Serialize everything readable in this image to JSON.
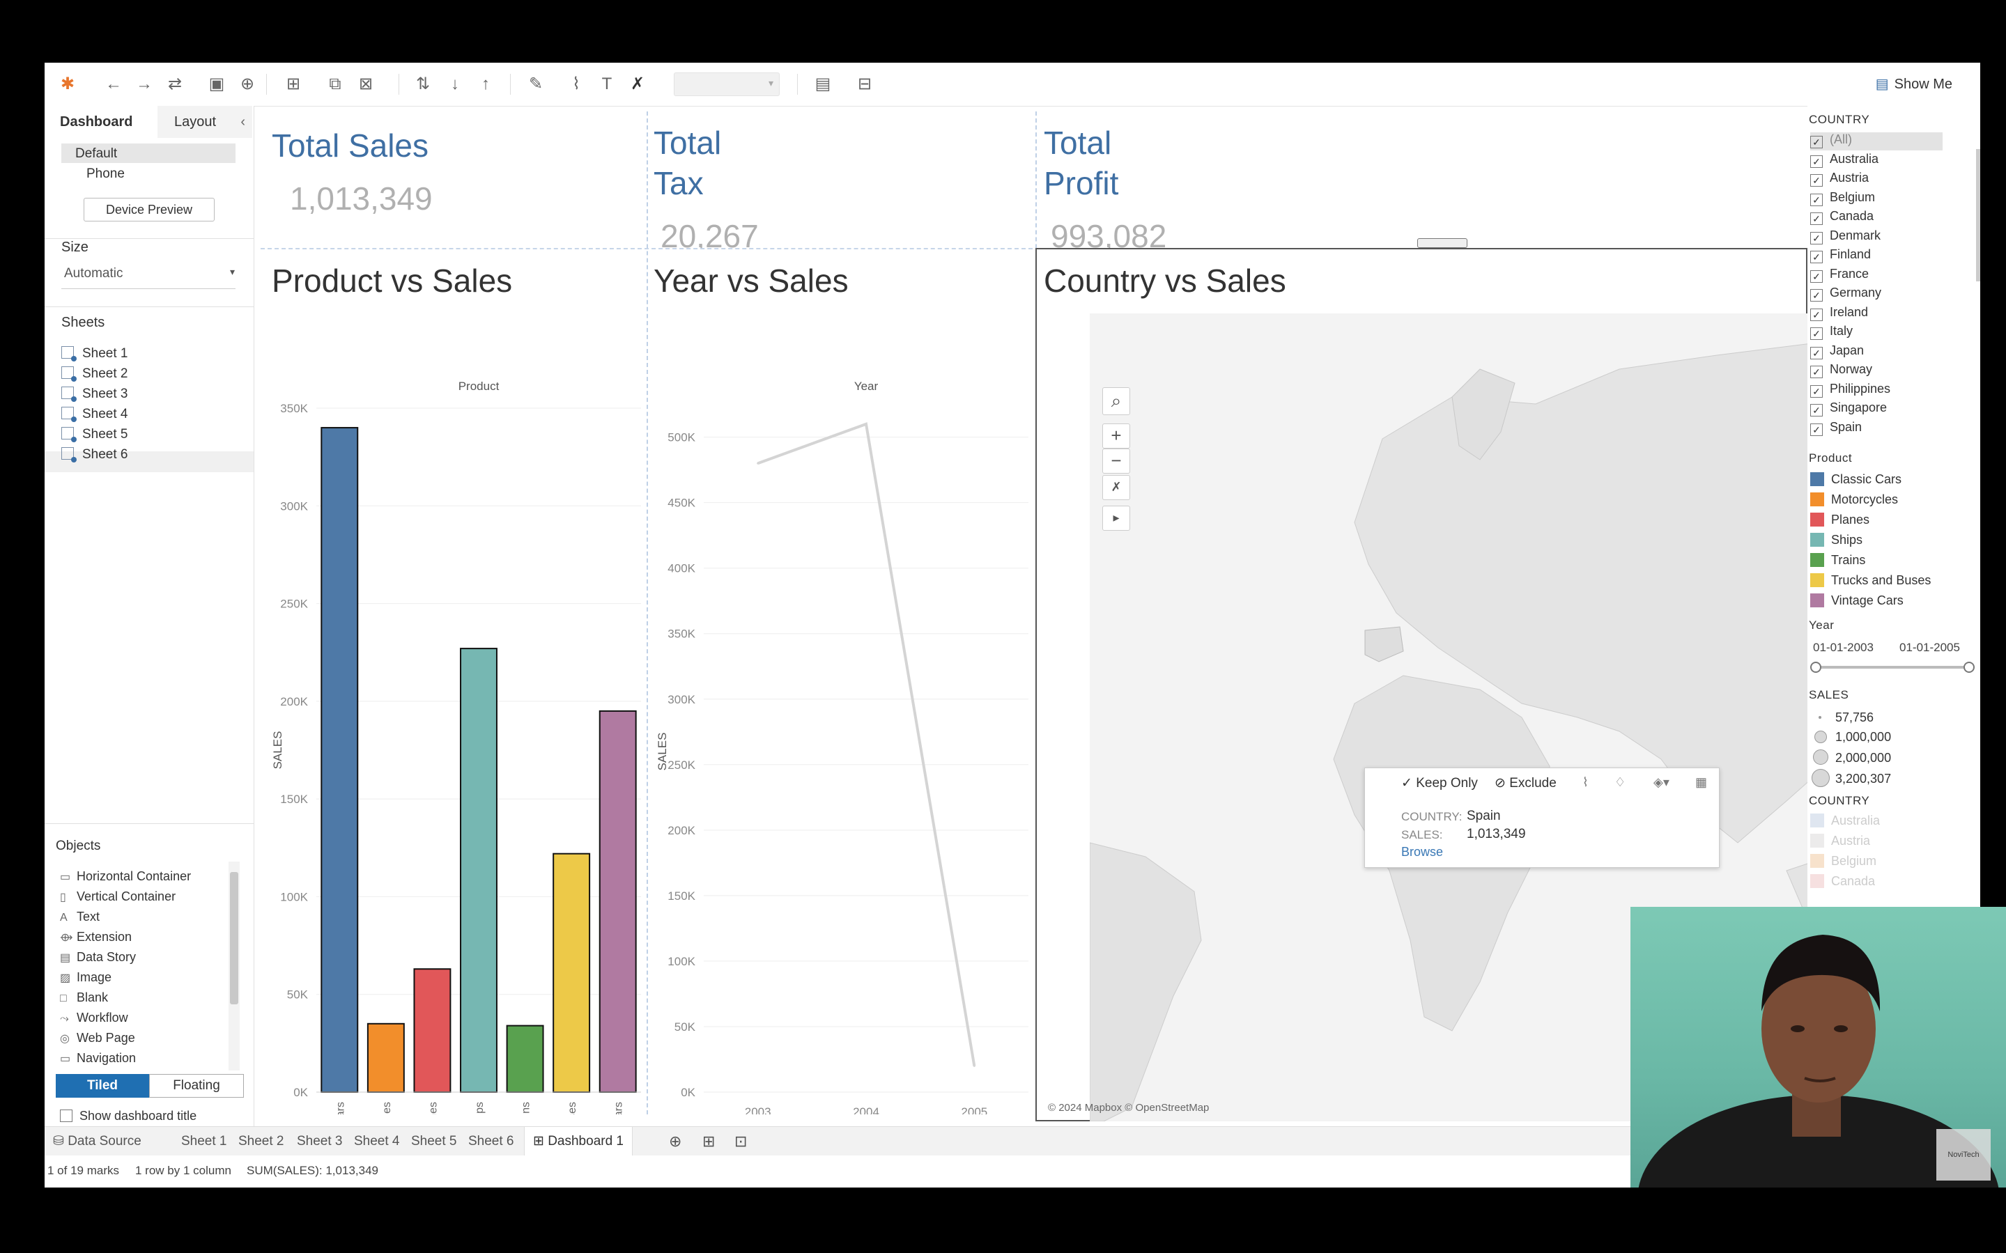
{
  "toolbar": {
    "show_me_label": "Show Me"
  },
  "left_panel": {
    "tabs": [
      "Dashboard",
      "Layout"
    ],
    "devices": [
      "Default",
      "Phone"
    ],
    "device_preview_label": "Device Preview",
    "size_heading": "Size",
    "size_value": "Automatic",
    "sheets_heading": "Sheets",
    "sheets": [
      "Sheet 1",
      "Sheet 2",
      "Sheet 3",
      "Sheet 4",
      "Sheet 5",
      "Sheet 6"
    ],
    "objects_heading": "Objects",
    "objects": [
      "Horizontal Container",
      "Vertical Container",
      "Text",
      "Extension",
      "Data Story",
      "Image",
      "Blank",
      "Workflow",
      "Web Page",
      "Navigation"
    ],
    "tiled_label": "Tiled",
    "floating_label": "Floating",
    "show_title_label": "Show dashboard title"
  },
  "kpis": {
    "total_sales_title": "Total Sales",
    "total_sales_value": "1,013,349",
    "total_tax_title_1": "Total",
    "total_tax_title_2": "Tax",
    "total_tax_value": "20,267",
    "total_profit_title_1": "Total",
    "total_profit_title_2": "Profit",
    "total_profit_value": "993,082"
  },
  "charts": {
    "product_title": "Product vs Sales",
    "year_title": "Year vs Sales",
    "country_title": "Country vs Sales",
    "map_attribution": "© 2024 Mapbox © OpenStreetMap"
  },
  "chart_data": [
    {
      "type": "bar",
      "title": "Product vs Sales",
      "xlabel": "Product",
      "ylabel": "SALES",
      "categories": [
        "Classic Cars",
        "Motorcycles",
        "Planes",
        "Ships",
        "Trains",
        "Trucks and Buses",
        "Vintage Cars"
      ],
      "values": [
        340000,
        35000,
        63000,
        227000,
        34000,
        122000,
        195000
      ],
      "colors": [
        "#4e79a7",
        "#f28e2b",
        "#e15759",
        "#76b7b2",
        "#59a14f",
        "#edc948",
        "#b07aa1"
      ],
      "ylim": [
        0,
        350000
      ],
      "yticks": [
        "0K",
        "50K",
        "100K",
        "150K",
        "200K",
        "250K",
        "300K",
        "350K"
      ]
    },
    {
      "type": "line",
      "title": "Year vs Sales",
      "xlabel": "Year",
      "ylabel": "SALES",
      "x": [
        "2003",
        "2004",
        "2005"
      ],
      "values": [
        480000,
        510000,
        20000
      ],
      "ylim": [
        0,
        520000
      ],
      "yticks": [
        "0K",
        "50K",
        "100K",
        "150K",
        "200K",
        "250K",
        "300K",
        "350K",
        "400K",
        "450K",
        "500K"
      ]
    }
  ],
  "tooltip": {
    "keep_only": "Keep Only",
    "exclude": "Exclude",
    "country_label": "COUNTRY:",
    "country_value": "Spain",
    "sales_label": "SALES:",
    "sales_value": "1,013,349",
    "browse": "Browse"
  },
  "legend": {
    "country_heading": "COUNTRY",
    "countries": [
      "(All)",
      "Australia",
      "Austria",
      "Belgium",
      "Canada",
      "Denmark",
      "Finland",
      "France",
      "Germany",
      "Ireland",
      "Italy",
      "Japan",
      "Norway",
      "Philippines",
      "Singapore",
      "Spain"
    ],
    "product_heading": "Product",
    "products": [
      {
        "name": "Classic Cars",
        "color": "#4e79a7"
      },
      {
        "name": "Motorcycles",
        "color": "#f28e2b"
      },
      {
        "name": "Planes",
        "color": "#e15759"
      },
      {
        "name": "Ships",
        "color": "#76b7b2"
      },
      {
        "name": "Trains",
        "color": "#59a14f"
      },
      {
        "name": "Trucks and Buses",
        "color": "#edc948"
      },
      {
        "name": "Vintage Cars",
        "color": "#b07aa1"
      }
    ],
    "year_heading": "Year",
    "year_start": "01-01-2003",
    "year_end": "01-01-2005",
    "sales_heading": "SALES",
    "sales_sizes": [
      "57,756",
      "1,000,000",
      "2,000,000",
      "3,200,307"
    ],
    "country2_heading": "COUNTRY",
    "country2_items": [
      "Australia",
      "Austria",
      "Belgium",
      "Canada"
    ]
  },
  "bottom_tabs": {
    "data_source": "Data Source",
    "sheets": [
      "Sheet 1",
      "Sheet 2",
      "Sheet 3",
      "Sheet 4",
      "Sheet 5",
      "Sheet 6"
    ],
    "dashboard": "Dashboard 1"
  },
  "status": {
    "marks": "1 of 19 marks",
    "rows": "1 row by 1 column",
    "sum": "SUM(SALES): 1,013,349"
  },
  "watermark": "NoviTech"
}
